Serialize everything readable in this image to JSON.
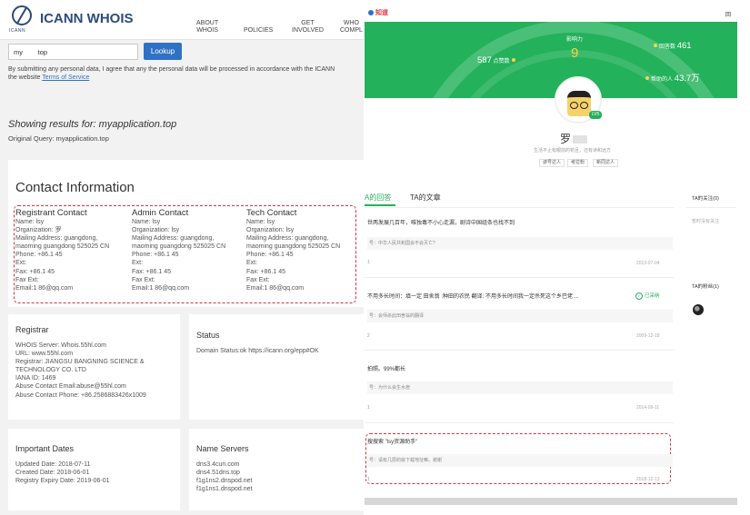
{
  "whois": {
    "logo_text": "ICANN",
    "site_title": "ICANN WHOIS",
    "nav": [
      {
        "line1": "ABOUT",
        "line2": "WHOIS"
      },
      {
        "line1": "POLICIES",
        "line2": ""
      },
      {
        "line1": "GET",
        "line2": "INVOLVED"
      },
      {
        "line1": "WHO",
        "line2": "COMPL"
      }
    ],
    "search_value": "my        top",
    "lookup_label": "Lookup",
    "disclaimer_line1": "By submitting any personal data, I agree that any the personal data will be processed in accordance with the ICANN",
    "disclaimer_line2": "the website ",
    "tos_label": "Terms of Service",
    "results_title": "Showing results for: myapplication.top",
    "original_query": "Original Query: myapplication.top",
    "contact_title": "Contact Information",
    "contacts": [
      {
        "heading": "Registrant Contact",
        "lines": [
          "Name: lsy",
          "Organization: 罗",
          "Mailing Address: guangdong,",
          "maoming guangdong 525025 CN",
          "Phone: +86.1            45",
          "Ext:",
          "Fax: +86.1            45",
          "Fax Ext:",
          "Email:1            86@qq.com"
        ]
      },
      {
        "heading": "Admin Contact",
        "lines": [
          "Name: lsy",
          "Organization: lsy",
          "Mailing Address: guangdong,",
          "maoming guangdong 525025 CN",
          "Phone: +86.1            45",
          "Ext:",
          "Fax: +86.1            45",
          "Fax Ext:",
          "Email:1            86@qq.com"
        ]
      },
      {
        "heading": "Tech Contact",
        "lines": [
          "Name: lsy",
          "Organization: lsy",
          "Mailing Address: guangdong,",
          "maoming guangdong 525025 CN",
          "Phone: +86.1            45",
          "Ext:",
          "Fax: +86.1            45",
          "Fax Ext:",
          "Email:1            86@qq.com"
        ]
      }
    ],
    "registrar": {
      "heading": "Registrar",
      "lines": [
        "WHOIS Server: Whois.55hl.com",
        "URL: www.55hl.com",
        "Registrar: JIANGSU BANGNING SCIENCE &",
        "TECHNOLOGY CO. LTD",
        "IANA ID: 1469",
        "Abuse Contact Email:abuse@55hl.com",
        "Abuse Contact Phone: +86.2586883426x1009"
      ]
    },
    "status": {
      "heading": "Status",
      "lines": [
        "Domain Status:ok https://icann.org/epp#OK"
      ]
    },
    "dates": {
      "heading": "Important Dates",
      "lines": [
        "Updated Date: 2018-07-11",
        "Created Date: 2018-06-01",
        "Registry Expiry Date: 2019-06-01"
      ]
    },
    "nameservers": {
      "heading": "Name Servers",
      "lines": [
        "dns3.4cun.com",
        "dns4.51dns.top",
        "f1g1ns2.dnspod.net",
        "f1g1ns1.dnspod.net"
      ]
    }
  },
  "profile": {
    "brand": "知道",
    "top_right": "回",
    "stats": {
      "center_label": "影响力",
      "center_value": "9",
      "left_value": "587",
      "left_label": "点赞数",
      "right1_label": "回答数",
      "right1_value": "461",
      "right2_label": "帮助的人",
      "right2_value": "43.7万"
    },
    "level_badge": "LV5",
    "name": "罗",
    "bio": "生活不止有眼前的苟且，还有诗和远方",
    "tags": [
      "谚号达人",
      "考拉粉",
      "新同达人"
    ],
    "tab_answers": "A的回答",
    "tab_articles": "TA的文章",
    "questions": [
      {
        "title": "世两发展几百年，唯独毒不小心走漏，剧诗中国组条也找不到",
        "answer": "号：中华人民共和国会不会灭亡?",
        "count": "1",
        "date": "2013-07-04"
      },
      {
        "title": "不用多长时间：填一定 田舍翁 :种田的农民 翻译: 不用多长时间我一定杀死这个乡巴佬 ...",
        "answer": "号：会师杀此田舍翁的翻译",
        "count": "2",
        "date": "2009-12-18",
        "adopted": "已采纳"
      },
      {
        "title": "拍照。99%都长",
        "answer": "号：为什么会生水痘",
        "count": "1",
        "date": "2014-09-11"
      },
      {
        "title": "搜搜索 \"lsy资源助手\"",
        "answer": "号：请有几层的就下载地址嘛。谢谢",
        "count": "1",
        "date": "2018-12-13"
      }
    ],
    "side_follow": "TA的关注(0)",
    "side_follow_empty": "暂时没有关注",
    "side_fans": "TA的粉丝(1)"
  }
}
